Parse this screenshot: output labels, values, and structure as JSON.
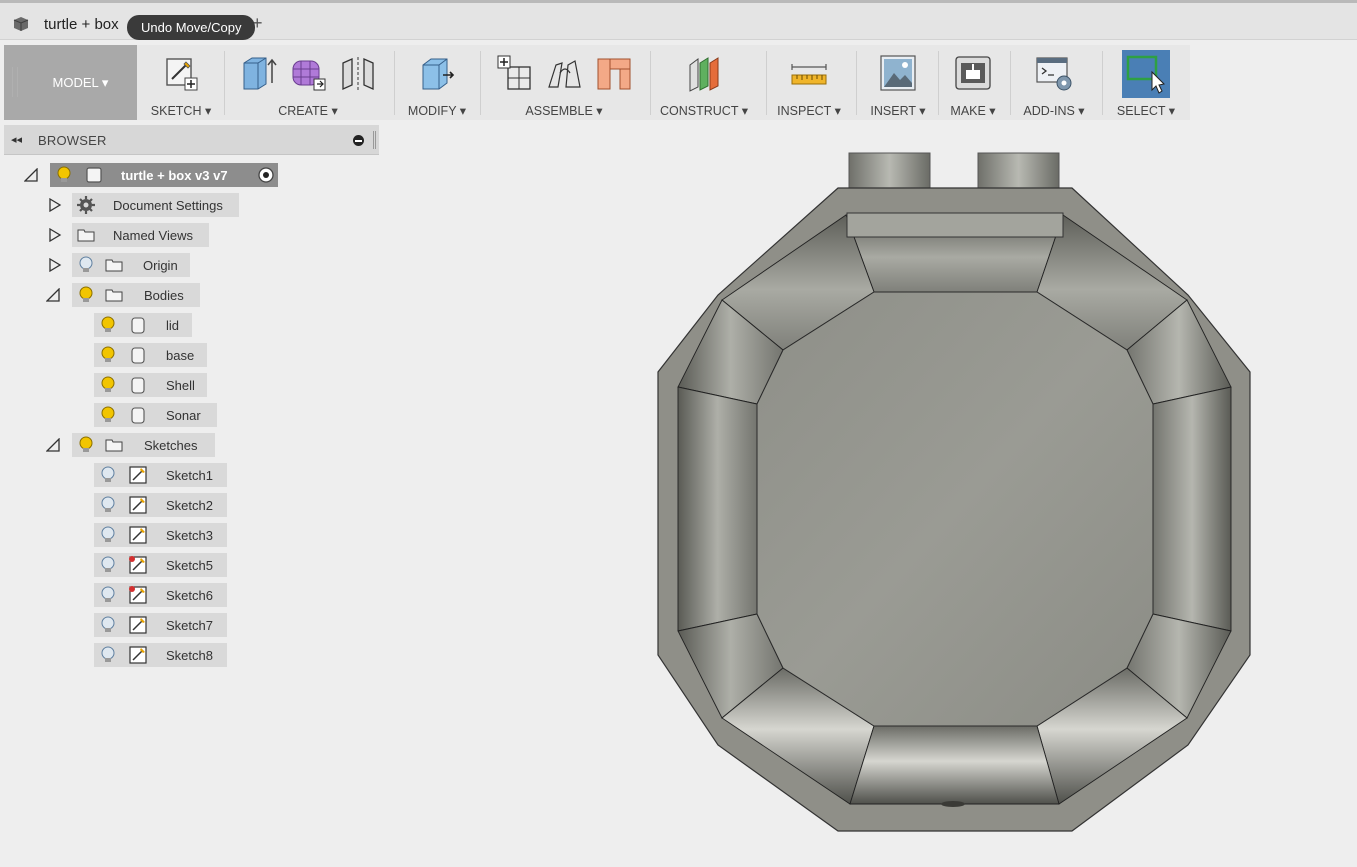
{
  "window": {
    "document_tab": "turtle + box",
    "tooltip": "Undo Move/Copy",
    "new_tab": "+"
  },
  "toolbar": {
    "workspace": "MODEL ▾",
    "groups": [
      {
        "label": "SKETCH ▾",
        "icons": [
          "create-sketch-icon"
        ]
      },
      {
        "label": "CREATE ▾",
        "icons": [
          "extrude-icon",
          "form-icon",
          "mirror-icon"
        ]
      },
      {
        "label": "MODIFY ▾",
        "icons": [
          "press-pull-icon"
        ]
      },
      {
        "label": "ASSEMBLE ▾",
        "icons": [
          "new-component-icon",
          "joint-icon",
          "as-built-joint-icon"
        ]
      },
      {
        "label": "CONSTRUCT ▾",
        "icons": [
          "offset-plane-icon"
        ]
      },
      {
        "label": "INSPECT ▾",
        "icons": [
          "measure-icon"
        ]
      },
      {
        "label": "INSERT ▾",
        "icons": [
          "insert-image-icon"
        ]
      },
      {
        "label": "MAKE ▾",
        "icons": [
          "3d-print-icon"
        ]
      },
      {
        "label": "ADD-INS ▾",
        "icons": [
          "scripts-addins-icon"
        ]
      },
      {
        "label": "SELECT ▾",
        "icons": [
          "select-icon"
        ]
      }
    ]
  },
  "browser": {
    "title": "BROWSER",
    "collapse": "◂◂",
    "root": "turtle + box v3 v7",
    "document_settings": "Document Settings",
    "named_views": "Named Views",
    "origin": "Origin",
    "bodies": {
      "label": "Bodies",
      "items": [
        "lid",
        "base",
        "Shell",
        "Sonar"
      ]
    },
    "sketches": {
      "label": "Sketches",
      "items": [
        "Sketch1",
        "Sketch2",
        "Sketch3",
        "Sketch5",
        "Sketch6",
        "Sketch7",
        "Sketch8"
      ],
      "warning_items": [
        "Sketch5",
        "Sketch6"
      ]
    }
  },
  "colors": {
    "accent_select": "#4a7fb5",
    "bulb_on": "#f2c500",
    "model_bg": "#a9a9a9",
    "body_gray": "#8f8f88"
  }
}
